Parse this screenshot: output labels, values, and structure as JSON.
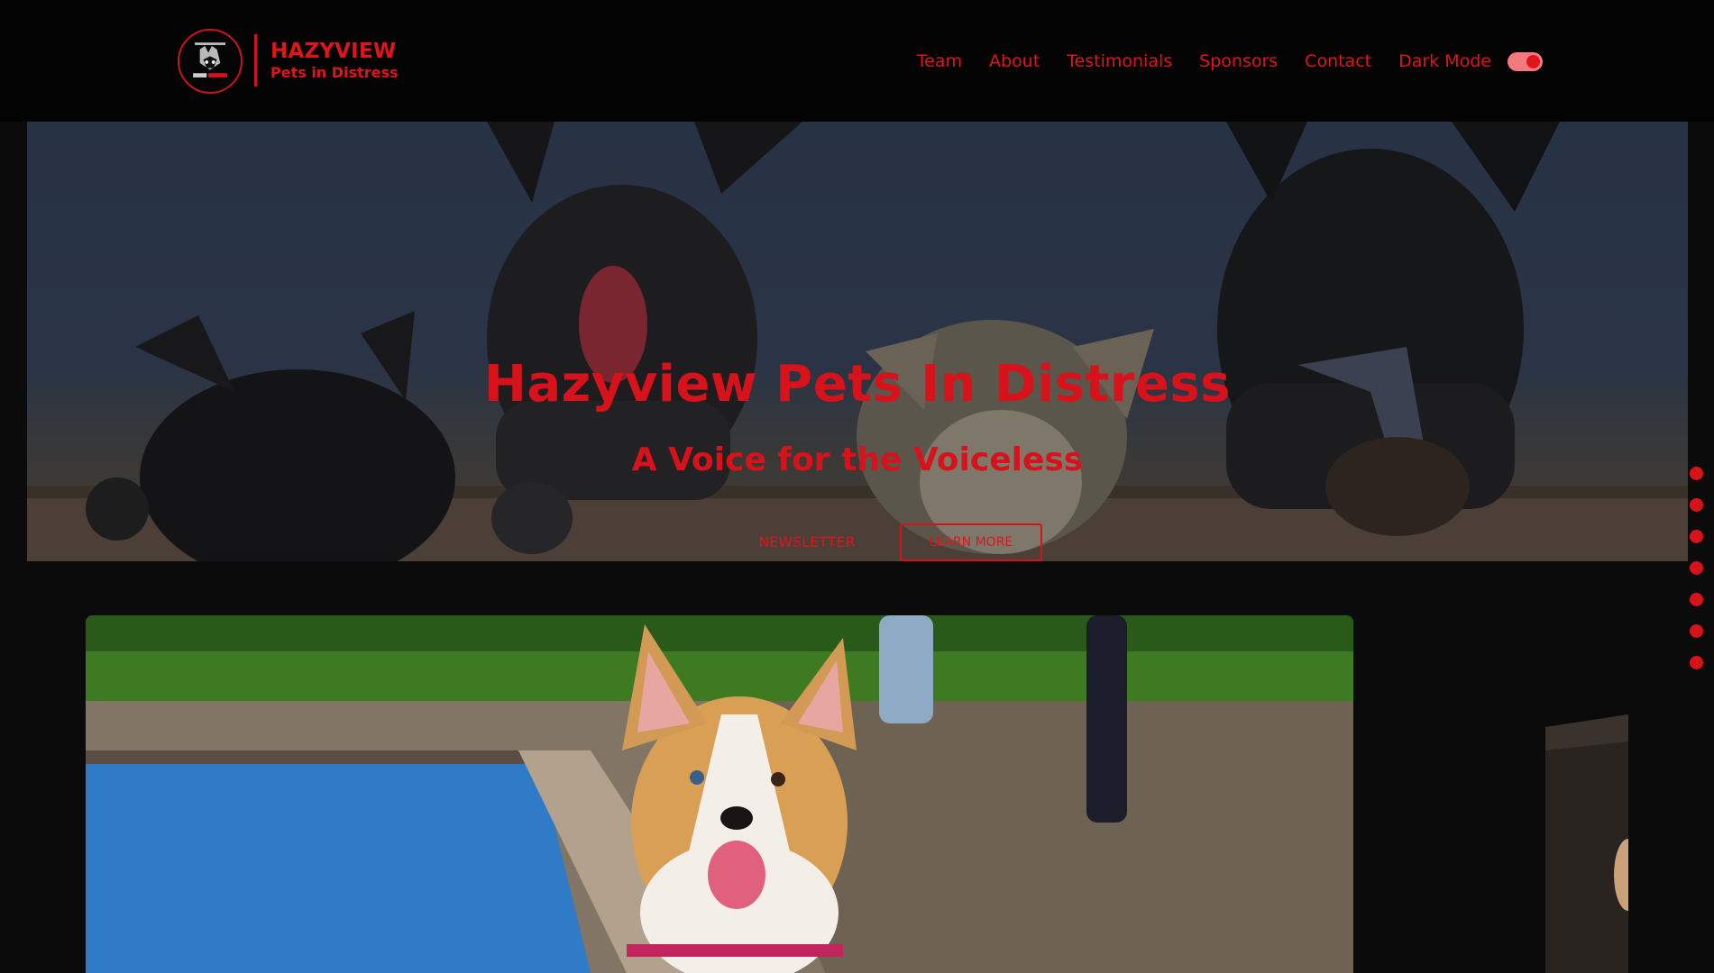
{
  "brand": {
    "name": "HAZYVIEW",
    "tagline": "Pets in Distress",
    "logo_icon": "paw-hands-logo"
  },
  "nav": {
    "links": [
      "Team",
      "About",
      "Testimonials",
      "Sponsors",
      "Contact"
    ],
    "dark_mode_label": "Dark Mode",
    "dark_mode_on": true
  },
  "hero": {
    "title": "Hazyview Pets In Distress",
    "subtitle": "A Voice for the Voiceless",
    "newsletter_label": "NEWSLETTER",
    "learn_more_label": "LEARN MORE"
  },
  "colors": {
    "accent": "#e0141b",
    "page_background": "#0b0b0b",
    "navbar_background": "#030303"
  },
  "carousel": {
    "current_image": "corgi-by-pond-photo",
    "next_image": "dog-photo-partial"
  },
  "section_dots": {
    "count": 7
  }
}
